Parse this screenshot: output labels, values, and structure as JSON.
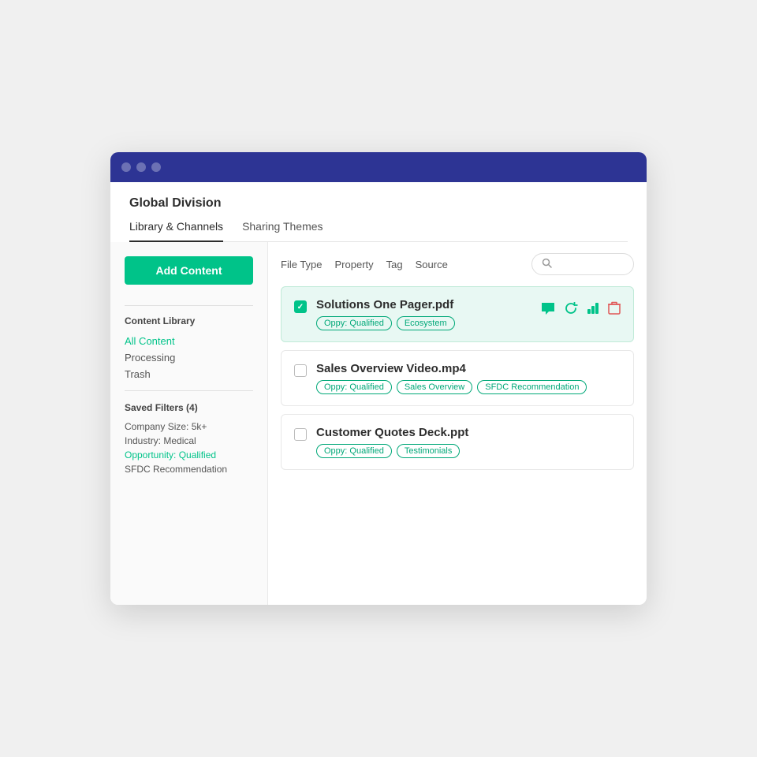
{
  "window": {
    "title": "Global Division"
  },
  "tabs": [
    {
      "label": "Library & Channels",
      "active": true
    },
    {
      "label": "Sharing Themes",
      "active": false
    }
  ],
  "sidebar": {
    "addContentButton": "Add Content",
    "contentLibraryTitle": "Content Library",
    "libraryItems": [
      {
        "label": "All Content",
        "active": true
      },
      {
        "label": "Processing",
        "active": false
      },
      {
        "label": "Trash",
        "active": false
      }
    ],
    "savedFiltersTitle": "Saved Filters (4)",
    "filterItems": [
      {
        "label": "Company Size: 5k+",
        "active": false
      },
      {
        "label": "Industry: Medical",
        "active": false
      },
      {
        "label": "Opportunity: Qualified",
        "active": true
      },
      {
        "label": "SFDC Recommendation",
        "active": false
      }
    ]
  },
  "toolbar": {
    "filters": [
      {
        "label": "File Type"
      },
      {
        "label": "Property"
      },
      {
        "label": "Tag"
      },
      {
        "label": "Source"
      }
    ],
    "searchPlaceholder": ""
  },
  "contentItems": [
    {
      "id": 1,
      "name": "Solutions One Pager.pdf",
      "selected": true,
      "tags": [
        "Oppy: Qualified",
        "Ecosystem"
      ],
      "hasActions": true
    },
    {
      "id": 2,
      "name": "Sales Overview Video.mp4",
      "selected": false,
      "tags": [
        "Oppy: Qualified",
        "Sales Overview",
        "SFDC Recommendation"
      ],
      "hasActions": false
    },
    {
      "id": 3,
      "name": "Customer Quotes Deck.ppt",
      "selected": false,
      "tags": [
        "Oppy: Qualified",
        "Testimonials"
      ],
      "hasActions": false
    }
  ],
  "icons": {
    "search": "🔍",
    "chat": "💬",
    "refresh": "↺",
    "bar": "📊",
    "trash": "🗑"
  }
}
